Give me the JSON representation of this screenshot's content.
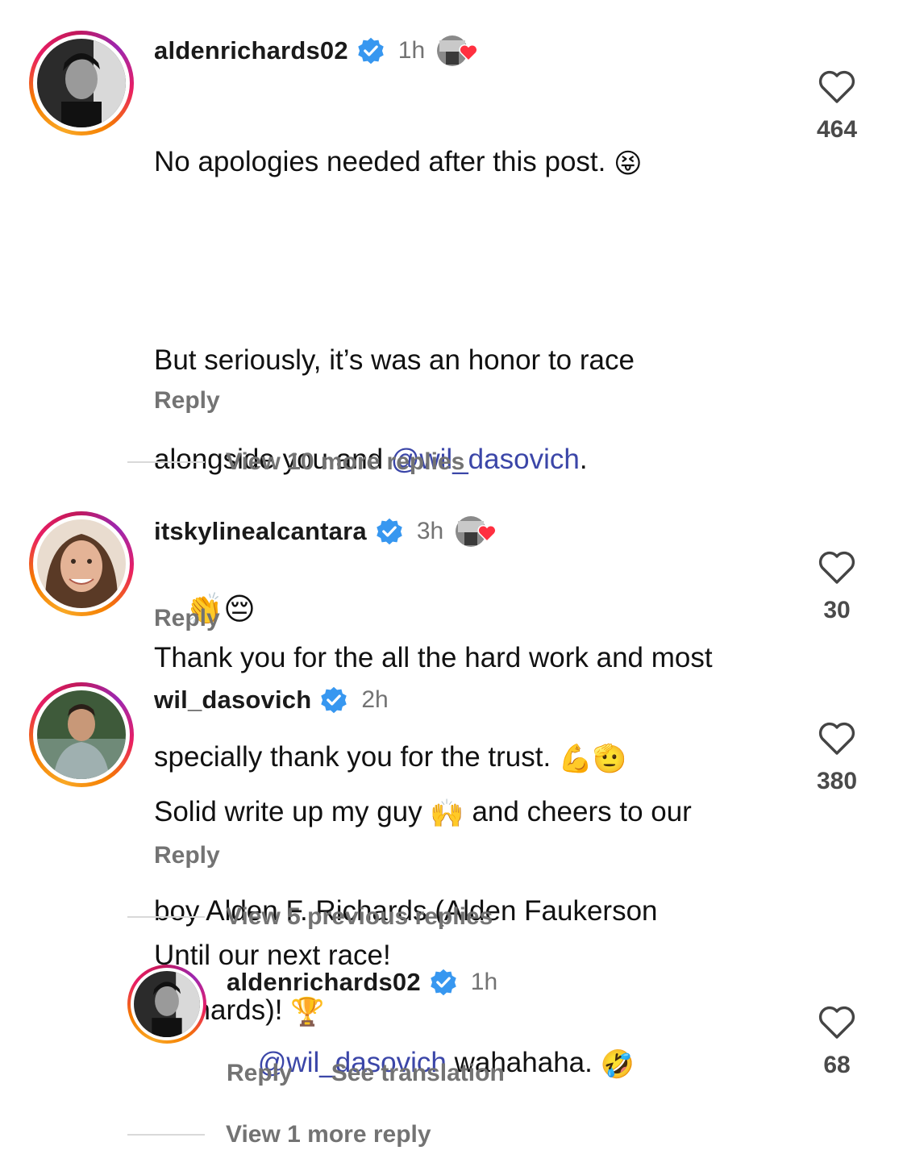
{
  "comments": [
    {
      "username": "aldenrichards02",
      "time": "1h",
      "liked_by_author": true,
      "lines": [
        "No apologies needed after this post."
      ],
      "para2_a": "But seriously, it’s was an honor to race",
      "para2_b_pre": "alongside you and ",
      "para2_mention": "@wil_dasovich",
      "para2_b_post": ".",
      "para3_a": "Thank you for the all the hard work and most",
      "para3_b": "specially thank you for the trust.",
      "para4": "Until our next race!",
      "emoji1": "😝",
      "emoji2": "💪",
      "emoji3": "🫡",
      "reply_label": "Reply",
      "likes": "464",
      "view_replies": "View 10 more replies"
    },
    {
      "username": "itskylinealcantara",
      "time": "3h",
      "liked_by_author": true,
      "text": "👏😔",
      "reply_label": "Reply",
      "likes": "30"
    },
    {
      "username": "wil_dasovich",
      "time": "2h",
      "line1_pre": "Solid write up my guy ",
      "emoji_hands": "🙌",
      "line1_post": " and cheers to our",
      "line2": "boy Alden F. Richards (Alden Faukerson",
      "line3": "Richards)! ",
      "emoji_trophy": "🏆",
      "reply_label": "Reply",
      "likes": "380",
      "view_replies": "View 5 previous replies"
    },
    {
      "username": "aldenrichards02",
      "time": "1h",
      "mention": "@wil_dasovich",
      "text_post": " wahahaha. ",
      "emoji": "🤣",
      "reply_label": "Reply",
      "translation_label": "See translation",
      "likes": "68",
      "view_replies": "View 1 more reply"
    }
  ],
  "colors": {
    "mention": "#3b46a8",
    "verified": "#3797f0",
    "muted": "#737373",
    "heart_liked": "#ff3040"
  },
  "icons": {
    "verified": "verified-badge-icon",
    "like": "heart-outline-icon",
    "author_like": "heart-filled-icon"
  }
}
